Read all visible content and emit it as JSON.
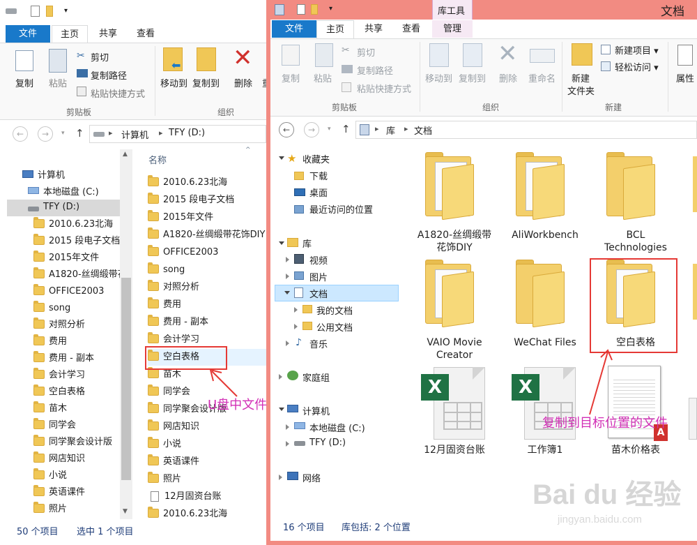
{
  "left": {
    "tabs": [
      "文件",
      "主页",
      "共享",
      "查看"
    ],
    "ribbon": {
      "copy": "复制",
      "paste": "粘贴",
      "cut": "剪切",
      "copy_path": "复制路径",
      "paste_shortcut": "粘贴快捷方式",
      "move_to": "移动到",
      "copy_to": "复制到",
      "delete": "删除",
      "rename_partial": "重",
      "group_clipboard": "剪贴板",
      "group_organize": "组织"
    },
    "breadcrumb": [
      "计算机",
      "TFY (D:)"
    ],
    "column_header": "名称",
    "tree": {
      "computer": "计算机",
      "local_disk": "本地磁盘 (C:)",
      "tfy": "TFY (D:)",
      "folders": [
        "2010.6.23北海",
        "2015 段电子文档",
        "2015年文件",
        "A1820-丝绸缎带花饰DIY",
        "OFFICE2003",
        "song",
        "对照分析",
        "费用",
        "费用 - 副本",
        "会计学习",
        "空白表格",
        "苗木",
        "同学会",
        "同学聚会设计版",
        "网店知识",
        "小说",
        "英语课件",
        "照片"
      ]
    },
    "files": [
      "2010.6.23北海",
      "2015 段电子文档",
      "2015年文件",
      "A1820-丝绸缎带花饰DIY",
      "OFFICE2003",
      "song",
      "对照分析",
      "费用",
      "费用 - 副本",
      "会计学习",
      "空白表格",
      "苗木",
      "同学会",
      "同学聚会设计版",
      "网店知识",
      "小说",
      "英语课件",
      "照片",
      "12月固资台账",
      "2010.6.23北海"
    ],
    "status_count": "50 个项目",
    "status_selected": "选中 1 个项目"
  },
  "right": {
    "title": "文档",
    "context_tab": "库工具",
    "tabs": [
      "文件",
      "主页",
      "共享",
      "查看",
      "管理"
    ],
    "ribbon": {
      "copy": "复制",
      "paste": "粘贴",
      "cut": "剪切",
      "copy_path": "复制路径",
      "paste_shortcut": "粘贴快捷方式",
      "move_to": "移动到",
      "copy_to": "复制到",
      "delete": "删除",
      "rename": "重命名",
      "new_folder_1": "新建",
      "new_folder_2": "文件夹",
      "new_item": "新建项目 ▾",
      "easy_access": "轻松访问 ▾",
      "properties": "属性",
      "group_clipboard": "剪贴板",
      "group_organize": "组织",
      "group_new": "新建"
    },
    "breadcrumb": [
      "库",
      "文档"
    ],
    "nav": {
      "favorites": "收藏夹",
      "downloads": "下载",
      "desktop": "桌面",
      "recent": "最近访问的位置",
      "libraries": "库",
      "videos": "视频",
      "pictures": "图片",
      "documents": "文档",
      "my_docs": "我的文档",
      "public_docs": "公用文档",
      "music": "音乐",
      "homegroup": "家庭组",
      "computer": "计算机",
      "local_disk": "本地磁盘 (C:)",
      "tfy": "TFY (D:)",
      "network": "网络"
    },
    "items": {
      "a1820_1": "A1820-丝绸缎带",
      "a1820_2": "花饰DIY",
      "aliworkbench": "AliWorkbench",
      "bcl_1": "BCL",
      "bcl_2": "Technologies",
      "vaio_1": "VAIO Movie",
      "vaio_2": "Creator",
      "wechat": "WeChat Files",
      "blank_sheet": "空白表格",
      "xls_1": "12月固资台账",
      "xls_2": "工作簿1",
      "pdf": "苗木价格表"
    },
    "status_count": "16 个项目",
    "status_lib": "库包括: 2 个位置"
  },
  "annotations": {
    "left_label": "U盘中文件",
    "right_label": "复制到目标位置的文件"
  },
  "watermark": {
    "brand": "Bai du 经验",
    "url": "jingyan.baidu.com"
  },
  "colors": {
    "accent_tab": "#1979ca",
    "window_border": "#f28b82",
    "annotation": "#d22fb6",
    "highlight_box": "#e53935",
    "selection": "#cce8ff"
  }
}
